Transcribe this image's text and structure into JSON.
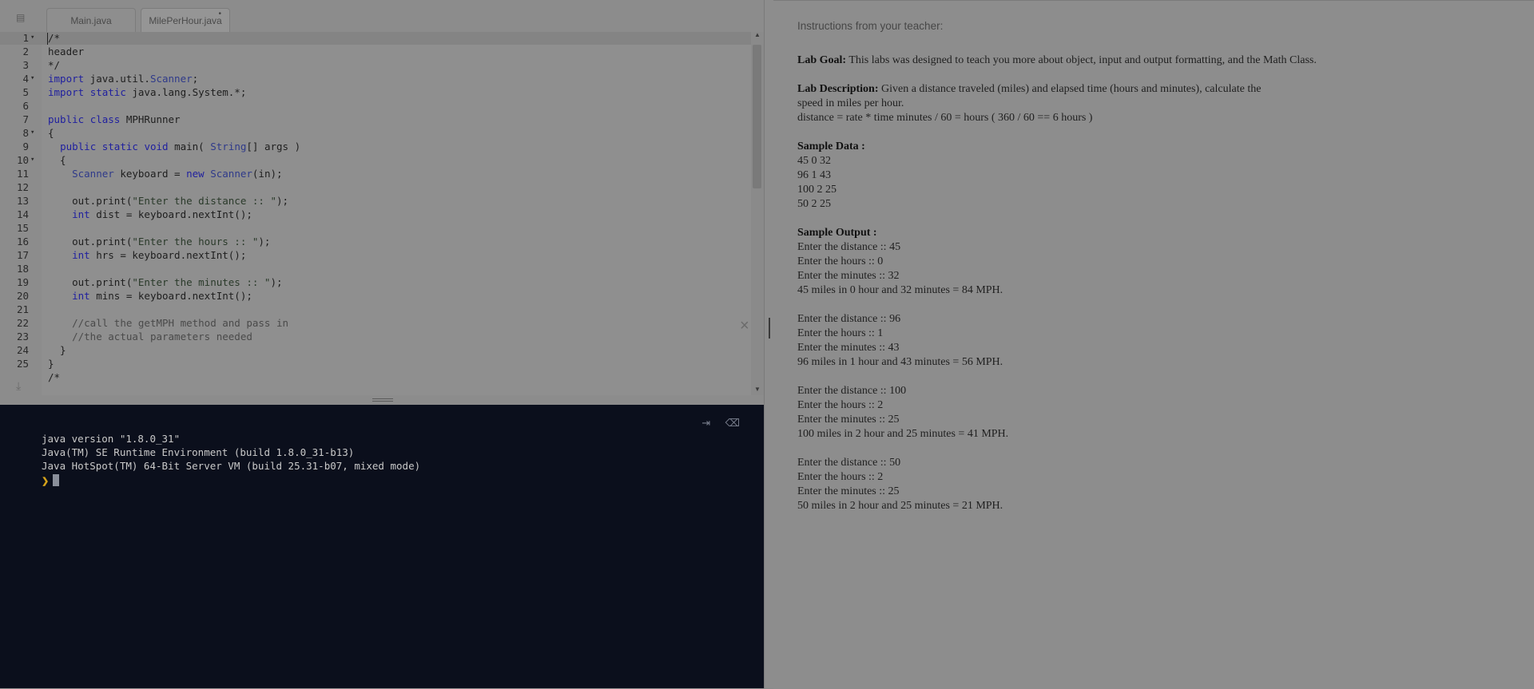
{
  "tabs": [
    {
      "label": "Main.java",
      "active": false
    },
    {
      "label": "MilePerHour.java",
      "active": true,
      "modified_marker": "•"
    }
  ],
  "editor": {
    "lines": [
      {
        "n": "1",
        "fold": "▾",
        "code": "/*"
      },
      {
        "n": "2",
        "fold": "",
        "code": "header"
      },
      {
        "n": "3",
        "fold": "",
        "code": "*/"
      },
      {
        "n": "4",
        "fold": "▾",
        "code": "import java.util.Scanner;"
      },
      {
        "n": "5",
        "fold": "",
        "code": "import static java.lang.System.*;"
      },
      {
        "n": "6",
        "fold": "",
        "code": ""
      },
      {
        "n": "7",
        "fold": "",
        "code": "public class MPHRunner"
      },
      {
        "n": "8",
        "fold": "▾",
        "code": "{"
      },
      {
        "n": "9",
        "fold": "",
        "code": "  public static void main( String[] args )"
      },
      {
        "n": "10",
        "fold": "▾",
        "code": "  {"
      },
      {
        "n": "11",
        "fold": "",
        "code": "    Scanner keyboard = new Scanner(in);"
      },
      {
        "n": "12",
        "fold": "",
        "code": ""
      },
      {
        "n": "13",
        "fold": "",
        "code": "    out.print(\"Enter the distance :: \");"
      },
      {
        "n": "14",
        "fold": "",
        "code": "    int dist = keyboard.nextInt();"
      },
      {
        "n": "15",
        "fold": "",
        "code": ""
      },
      {
        "n": "16",
        "fold": "",
        "code": "    out.print(\"Enter the hours :: \");"
      },
      {
        "n": "17",
        "fold": "",
        "code": "    int hrs = keyboard.nextInt();"
      },
      {
        "n": "18",
        "fold": "",
        "code": ""
      },
      {
        "n": "19",
        "fold": "",
        "code": "    out.print(\"Enter the minutes :: \");"
      },
      {
        "n": "20",
        "fold": "",
        "code": "    int mins = keyboard.nextInt();"
      },
      {
        "n": "21",
        "fold": "",
        "code": ""
      },
      {
        "n": "22",
        "fold": "",
        "code": "    //call the getMPH method and pass in"
      },
      {
        "n": "23",
        "fold": "",
        "code": "    //the actual parameters needed"
      },
      {
        "n": "24",
        "fold": "",
        "code": "  }"
      },
      {
        "n": "25",
        "fold": "",
        "code": "}"
      },
      {
        "n": "",
        "fold": "",
        "code": "/*"
      }
    ]
  },
  "terminal": {
    "lines": [
      "java version \"1.8.0_31\"",
      "Java(TM) SE Runtime Environment (build 1.8.0_31-b13)",
      "Java HotSpot(TM) 64-Bit Server VM (build 25.31-b07, mixed mode)"
    ],
    "prompt": "❯"
  },
  "instructions": {
    "title": "Instructions from your teacher:",
    "goal_label": "Lab Goal:",
    "goal_text": " This labs was designed to teach you more about object, input and output formatting, and the Math Class.",
    "desc_label": "Lab Description:",
    "desc_text_1": "  Given a distance traveled (miles) and elapsed time (hours and minutes), calculate the",
    "desc_text_2": "speed in miles per hour.",
    "desc_text_3": "distance = rate * time minutes / 60 = hours ( 360 / 60 == 6 hours )",
    "sample_data_label": "Sample Data :",
    "sample_data": [
      "45 0 32",
      "96 1 43",
      "100 2 25",
      "50 2 25"
    ],
    "sample_output_label": "Sample Output :",
    "sample_output": [
      [
        "Enter the distance :: 45",
        "Enter the hours :: 0",
        "Enter the minutes :: 32",
        "45 miles in 0 hour and 32 minutes = 84 MPH."
      ],
      [
        "Enter the distance :: 96",
        "Enter the hours :: 1",
        "Enter the minutes :: 43",
        "96 miles in 1 hour and 43 minutes = 56 MPH."
      ],
      [
        "Enter the distance :: 100",
        "Enter the hours :: 2",
        "Enter the minutes :: 25",
        "100 miles in 2 hour and 25 minutes = 41 MPH."
      ],
      [
        "Enter the distance :: 50",
        "Enter the hours :: 2",
        "Enter the minutes :: 25",
        "50 miles in 2 hour and 25 minutes = 21 MPH."
      ]
    ]
  }
}
